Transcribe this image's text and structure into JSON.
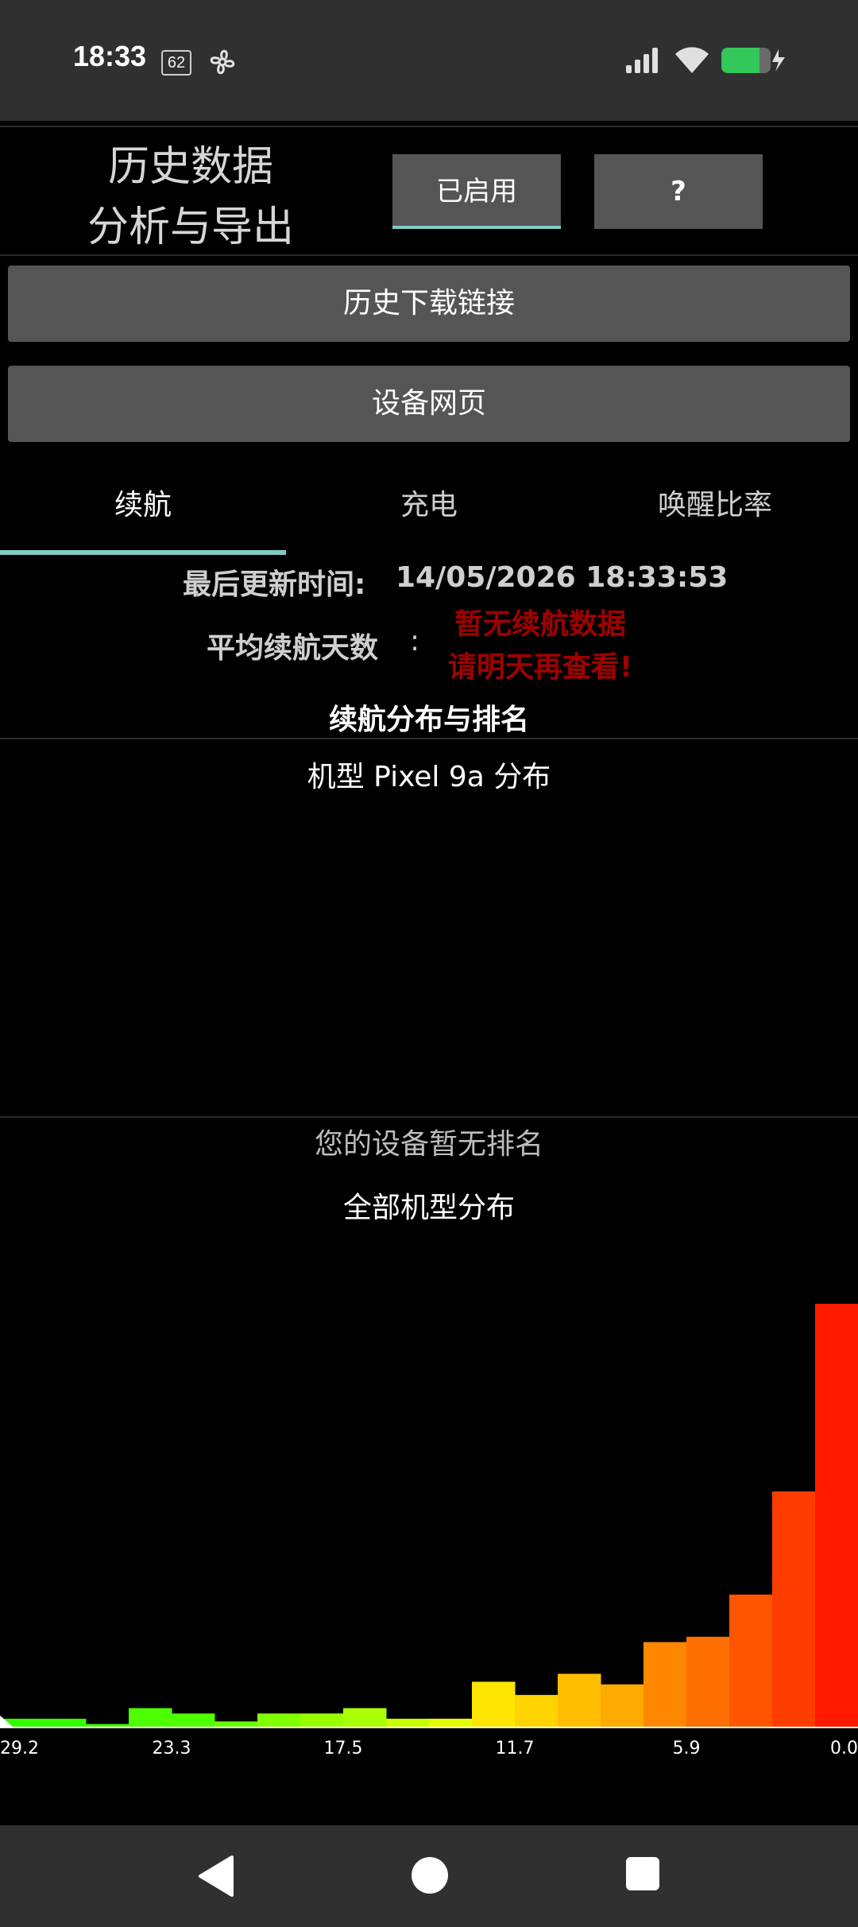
{
  "status_bar": {
    "time": "18:33",
    "badge": "62"
  },
  "header": {
    "title_line1": "历史数据",
    "title_line2": "分析与导出",
    "enabled_button": "已启用",
    "help_button": "?"
  },
  "buttons": {
    "history_download": "历史下载链接",
    "device_webpage": "设备网页"
  },
  "tabs": [
    {
      "label": "续航",
      "active": true
    },
    {
      "label": "充电",
      "active": false
    },
    {
      "label": "唤醒比率",
      "active": false
    }
  ],
  "info": {
    "last_update_label": "最后更新时间:",
    "last_update_value": "14/05/2026 18:33:53",
    "avg_days_label": "平均续航天数",
    "colon": ":",
    "no_data_line1": "暂无续航数据",
    "no_data_line2": "请明天再查看!"
  },
  "section": {
    "title": "续航分布与排名",
    "model_dist": "机型 Pixel 9a 分布",
    "no_rank": "您的设备暂无排名",
    "all_dist": "全部机型分布"
  },
  "chart_data": {
    "type": "bar",
    "title": "全部机型分布",
    "x_ticks": [
      "29.2",
      "23.3",
      "17.5",
      "11.7",
      "5.9",
      "0.0"
    ],
    "values": [
      3,
      3,
      1,
      7,
      5,
      2,
      5,
      5,
      7,
      3,
      3,
      17,
      12,
      20,
      16,
      32,
      34,
      50,
      89,
      160
    ],
    "colors": [
      "#33ff00",
      "#33ff00",
      "#40ff00",
      "#4dff00",
      "#4dff00",
      "#66ff00",
      "#80ff00",
      "#99ff00",
      "#aaff00",
      "#c8ff00",
      "#e6ff00",
      "#ffe600",
      "#ffd400",
      "#ffbf00",
      "#ffaa00",
      "#ff8800",
      "#ff7000",
      "#ff5500",
      "#ff3c00",
      "#ff1a00"
    ],
    "ylim": [
      0,
      160
    ]
  },
  "colors": {
    "accent": "#80cbc4",
    "button_bg": "#555555",
    "error_red": "#a00000"
  }
}
